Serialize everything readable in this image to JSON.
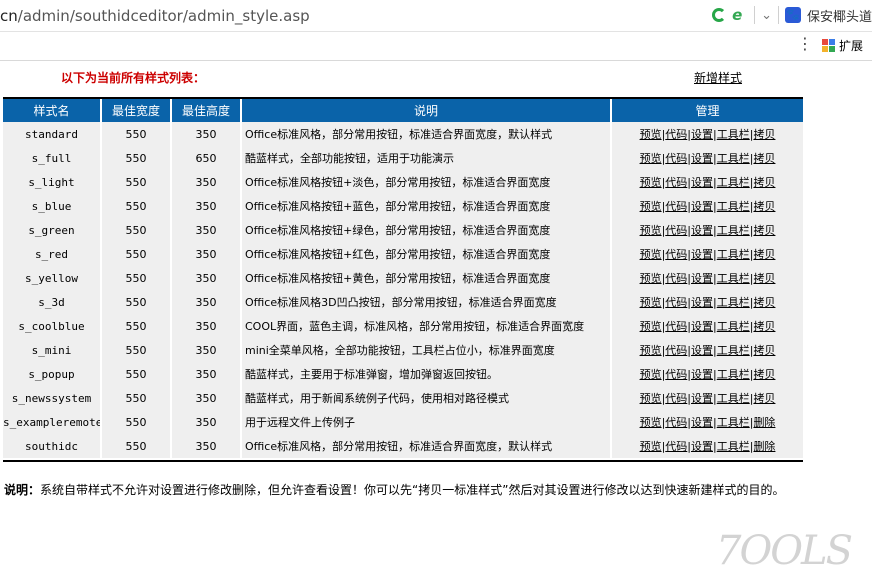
{
  "browser": {
    "url_proto": "cn",
    "url_path": "/admin/southidceditor/admin_style.asp",
    "search_text": "保安椰头道",
    "extensions_label": "扩展"
  },
  "page": {
    "heading": "以下为当前所有样式列表：",
    "add_link": "新增样式"
  },
  "table": {
    "headers": [
      "样式名",
      "最佳宽度",
      "最佳高度",
      "说明",
      "管理"
    ],
    "rows": [
      {
        "name": "standard",
        "width": "550",
        "height": "350",
        "desc": "Office标准风格，部分常用按钮，标准适合界面宽度，默认样式",
        "ops": [
          "预览",
          "代码",
          "设置",
          "工具栏",
          "拷贝"
        ]
      },
      {
        "name": "s_full",
        "width": "550",
        "height": "650",
        "desc": "酷蓝样式，全部功能按钮，适用于功能演示",
        "ops": [
          "预览",
          "代码",
          "设置",
          "工具栏",
          "拷贝"
        ]
      },
      {
        "name": "s_light",
        "width": "550",
        "height": "350",
        "desc": "Office标准风格按钮+淡色，部分常用按钮，标准适合界面宽度",
        "ops": [
          "预览",
          "代码",
          "设置",
          "工具栏",
          "拷贝"
        ]
      },
      {
        "name": "s_blue",
        "width": "550",
        "height": "350",
        "desc": "Office标准风格按钮+蓝色，部分常用按钮，标准适合界面宽度",
        "ops": [
          "预览",
          "代码",
          "设置",
          "工具栏",
          "拷贝"
        ]
      },
      {
        "name": "s_green",
        "width": "550",
        "height": "350",
        "desc": "Office标准风格按钮+绿色，部分常用按钮，标准适合界面宽度",
        "ops": [
          "预览",
          "代码",
          "设置",
          "工具栏",
          "拷贝"
        ]
      },
      {
        "name": "s_red",
        "width": "550",
        "height": "350",
        "desc": "Office标准风格按钮+红色，部分常用按钮，标准适合界面宽度",
        "ops": [
          "预览",
          "代码",
          "设置",
          "工具栏",
          "拷贝"
        ]
      },
      {
        "name": "s_yellow",
        "width": "550",
        "height": "350",
        "desc": "Office标准风格按钮+黄色，部分常用按钮，标准适合界面宽度",
        "ops": [
          "预览",
          "代码",
          "设置",
          "工具栏",
          "拷贝"
        ]
      },
      {
        "name": "s_3d",
        "width": "550",
        "height": "350",
        "desc": "Office标准风格3D凹凸按钮，部分常用按钮，标准适合界面宽度",
        "ops": [
          "预览",
          "代码",
          "设置",
          "工具栏",
          "拷贝"
        ]
      },
      {
        "name": "s_coolblue",
        "width": "550",
        "height": "350",
        "desc": "COOL界面，蓝色主调，标准风格，部分常用按钮，标准适合界面宽度",
        "ops": [
          "预览",
          "代码",
          "设置",
          "工具栏",
          "拷贝"
        ]
      },
      {
        "name": "s_mini",
        "width": "550",
        "height": "350",
        "desc": "mini全菜单风格，全部功能按钮，工具栏占位小，标准界面宽度",
        "ops": [
          "预览",
          "代码",
          "设置",
          "工具栏",
          "拷贝"
        ]
      },
      {
        "name": "s_popup",
        "width": "550",
        "height": "350",
        "desc": "酷蓝样式，主要用于标准弹窗，增加弹窗返回按钮。",
        "ops": [
          "预览",
          "代码",
          "设置",
          "工具栏",
          "拷贝"
        ]
      },
      {
        "name": "s_newssystem",
        "width": "550",
        "height": "350",
        "desc": "酷蓝样式，用于新闻系统例子代码，使用相对路径模式",
        "ops": [
          "预览",
          "代码",
          "设置",
          "工具栏",
          "拷贝"
        ]
      },
      {
        "name": "s_exampleremote",
        "width": "550",
        "height": "350",
        "desc": "用于远程文件上传例子",
        "ops": [
          "预览",
          "代码",
          "设置",
          "工具栏",
          "删除"
        ]
      },
      {
        "name": "southidc",
        "width": "550",
        "height": "350",
        "desc": "Office标准风格，部分常用按钮，标准适合界面宽度，默认样式",
        "ops": [
          "预览",
          "代码",
          "设置",
          "工具栏",
          "删除"
        ]
      }
    ]
  },
  "note": {
    "label": "说明：",
    "text": "系统自带样式不允许对设置进行修改删除，但允许查看设置！你可以先“拷贝一标准样式”然后对其设置进行修改以达到快速新建样式的目的。"
  },
  "watermark": "7OOLS",
  "colors": {
    "header_bg": "#0a63a9",
    "row_bg": "#efefef",
    "heading_red": "#cc0000"
  }
}
